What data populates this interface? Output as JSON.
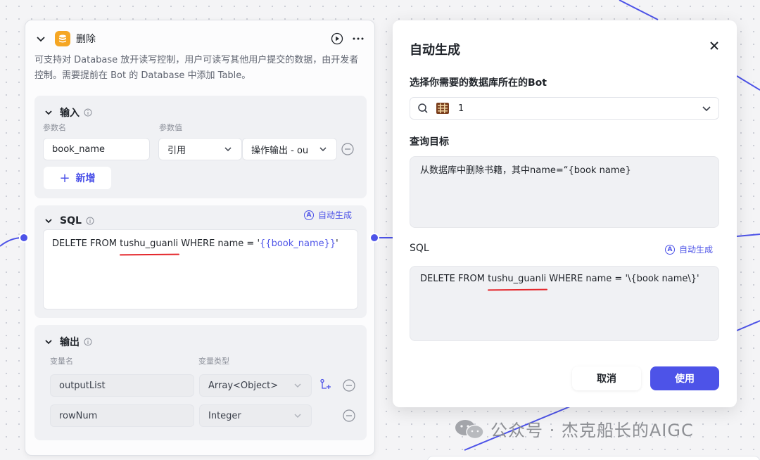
{
  "node": {
    "title": "删除",
    "description": "可支持对 Database 放开读写控制，用户可读写其他用户提交的数据，由开发者控制。需要提前在 Bot 的 Database 中添加 Table。",
    "input": {
      "title": "输入",
      "col_name": "参数名",
      "col_value": "参数值",
      "param_name": "book_name",
      "source": "引用",
      "ref_value": "操作输出 - ou",
      "add_label": "新增"
    },
    "sql": {
      "title": "SQL",
      "auto_label": "自动生成",
      "statement_prefix": "DELETE FROM ",
      "table": "tushu_guanli",
      "statement_mid": " WHERE name = '",
      "variable": "{{book_name}}",
      "statement_suffix": "'"
    },
    "output": {
      "title": "输出",
      "col_name": "变量名",
      "col_type": "变量类型",
      "rows": [
        {
          "name": "outputList",
          "type": "Array<Object>"
        },
        {
          "name": "rowNum",
          "type": "Integer"
        }
      ]
    }
  },
  "dialog": {
    "title": "自动生成",
    "bot_label": "选择你需要的数据库所在的Bot",
    "bot_value": "1",
    "query_label": "查询目标",
    "query_text": "从数据库中删除书籍，其中name=“{book name}",
    "sql_label": "SQL",
    "auto_label": "自动生成",
    "sql_prefix": "DELETE FROM ",
    "sql_table": "tushu_guanli",
    "sql_suffix": " WHERE name = '\\{book name\\}'",
    "cancel_label": "取消",
    "use_label": "使用"
  },
  "watermark": "公众号 · 杰克船长的AIGC",
  "colors": {
    "accent": "#4d53e8",
    "underline": "#e4262b",
    "db_icon": "#f5a623"
  }
}
